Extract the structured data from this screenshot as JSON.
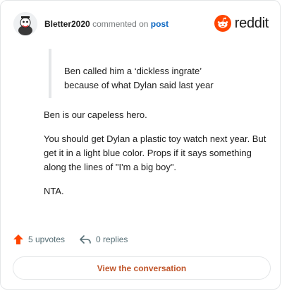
{
  "header": {
    "username": "Bletter2020",
    "verb": "commented on",
    "link": "post",
    "brand": "reddit",
    "brand_color": "#ff4500"
  },
  "quote": {
    "lines": [
      "Ben called him a ‘dickless ingrate’",
      "because of what Dylan said last year"
    ]
  },
  "body": {
    "paragraphs": [
      "Ben is our capeless hero.",
      "You should get Dylan a plastic toy watch next year. But get it in a light blue color. Props if it says something along the lines of \"I'm a big boy\".",
      "NTA."
    ]
  },
  "footer": {
    "upvotes": "5 upvotes",
    "replies": "0 replies",
    "upvote_icon": "upvote-arrow-icon",
    "reply_icon": "reply-arrow-icon"
  },
  "cta": {
    "label": "View the conversation"
  }
}
